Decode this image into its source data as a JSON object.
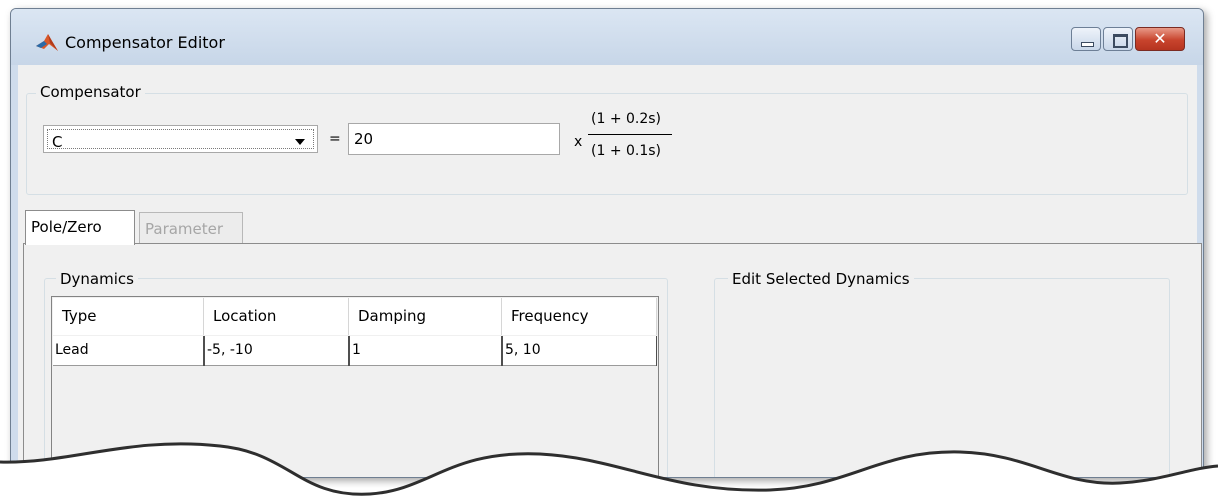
{
  "window": {
    "title": "Compensator Editor"
  },
  "compensator": {
    "group_label": "Compensator",
    "selected": "C",
    "equals": "=",
    "gain": "20",
    "times": "x",
    "numerator": "(1 + 0.2s)",
    "denominator": "(1 + 0.1s)"
  },
  "tabs": [
    {
      "label": "Pole/Zero",
      "active": true
    },
    {
      "label": "Parameter",
      "active": false
    }
  ],
  "dynamics": {
    "group_label": "Dynamics",
    "columns": [
      "Type",
      "Location",
      "Damping",
      "Frequency"
    ],
    "rows": [
      [
        "Lead",
        "-5, -10",
        "1",
        "5, 10"
      ]
    ]
  },
  "edit_selected": {
    "group_label": "Edit Selected Dynamics"
  },
  "colors": {
    "title_bar": "#cfdcec",
    "close_button": "#c8442d",
    "panel_bg": "#f0f0f0"
  }
}
